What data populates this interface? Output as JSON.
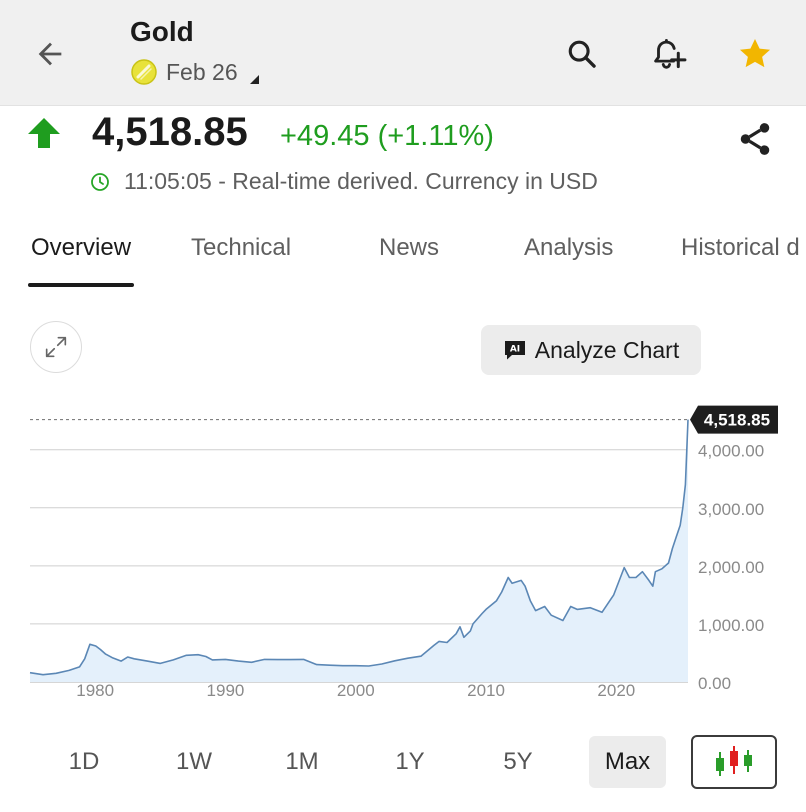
{
  "header": {
    "title": "Gold",
    "contract": "Feb 26",
    "icons": [
      "back-arrow-icon",
      "search-icon",
      "add-alert-icon",
      "star-icon"
    ],
    "star_color": "#f2b600"
  },
  "quote": {
    "price": "4,518.85",
    "change": "+49.45 (+1.11%)",
    "status": "11:05:05 - Real-time derived. Currency in USD",
    "up_color": "#1f9d1f"
  },
  "tabs": [
    "Overview",
    "Technical",
    "News",
    "Analysis",
    "Historical d"
  ],
  "chart_controls": {
    "analyze_label": "Analyze Chart"
  },
  "chart_data": {
    "type": "area",
    "title": "",
    "xlabel": "",
    "ylabel": "",
    "x_ticks": [
      "1980",
      "1990",
      "2000",
      "2010",
      "2020"
    ],
    "y_ticks": [
      "0.00",
      "1,000.00",
      "2,000.00",
      "3,000.00",
      "4,000.00"
    ],
    "y_tick_values": [
      0,
      1000,
      2000,
      3000,
      4000
    ],
    "xlim": [
      1975,
      2025.5
    ],
    "ylim": [
      0,
      4650
    ],
    "grid": true,
    "last_value_label": "4,518.85",
    "line_color": "#5b87b5",
    "fill_color": "#e4f0fb",
    "series": [
      {
        "x": [
          1975,
          1976,
          1977,
          1978,
          1978.8,
          1979.2,
          1979.6,
          1980.05,
          1980.4,
          1980.8,
          1981.3,
          1982,
          1982.5,
          1983,
          1984,
          1985,
          1986,
          1987,
          1987.9,
          1988.5,
          1989,
          1990,
          1991,
          1992,
          1993,
          1994,
          1995,
          1996,
          1997,
          1998,
          1999,
          2000,
          2001,
          2002,
          2003,
          2004,
          2005,
          2006,
          2006.4,
          2007,
          2007.7,
          2008,
          2008.3,
          2008.8,
          2009,
          2009.7,
          2010,
          2010.8,
          2011.2,
          2011.7,
          2012,
          2012.7,
          2013,
          2013.4,
          2013.8,
          2014.5,
          2015,
          2015.9,
          2016.5,
          2017,
          2018,
          2018.9,
          2019.5,
          2019.8,
          2020.6,
          2021,
          2021.5,
          2022,
          2022.5,
          2022.8,
          2023,
          2023.5,
          2024,
          2024.3,
          2024.6,
          2024.9,
          2025.1,
          2025.3,
          2025.5
        ],
        "y": [
          160,
          125,
          150,
          200,
          260,
          400,
          650,
          620,
          560,
          480,
          420,
          360,
          430,
          400,
          360,
          320,
          380,
          460,
          470,
          440,
          380,
          390,
          360,
          340,
          390,
          385,
          385,
          390,
          300,
          290,
          280,
          280,
          275,
          310,
          365,
          410,
          445,
          630,
          700,
          680,
          830,
          950,
          770,
          880,
          1000,
          1180,
          1250,
          1400,
          1550,
          1800,
          1700,
          1750,
          1650,
          1400,
          1230,
          1300,
          1150,
          1060,
          1300,
          1250,
          1280,
          1200,
          1400,
          1500,
          1970,
          1800,
          1800,
          1900,
          1750,
          1650,
          1900,
          1950,
          2050,
          2300,
          2500,
          2700,
          3000,
          3400,
          4518.85
        ]
      }
    ]
  },
  "ranges": [
    "1D",
    "1W",
    "1M",
    "1Y",
    "5Y",
    "Max"
  ],
  "active_range": "Max"
}
